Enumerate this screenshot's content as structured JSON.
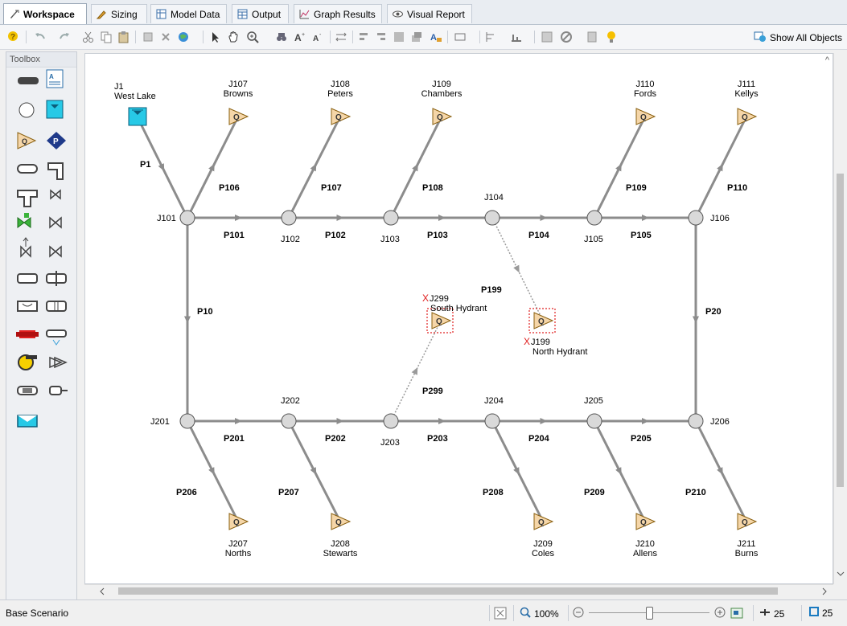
{
  "tabs": [
    {
      "label": "Workspace",
      "icon": "workspace-icon",
      "active": true
    },
    {
      "label": "Sizing",
      "icon": "pencil-icon",
      "active": false
    },
    {
      "label": "Model Data",
      "icon": "model-data-icon",
      "active": false
    },
    {
      "label": "Output",
      "icon": "output-table-icon",
      "active": false
    },
    {
      "label": "Graph Results",
      "icon": "graph-icon",
      "active": false
    },
    {
      "label": "Visual Report",
      "icon": "eye-icon",
      "active": false
    }
  ],
  "toolbar": {
    "show_all_label": "Show All Objects"
  },
  "toolbox": {
    "title": "Toolbox",
    "tools": [
      "pipe-tool",
      "annotation-tool",
      "branch-tool",
      "reservoir-tool",
      "assigned-flow-tool",
      "assigned-pressure-tool",
      "bend-tool",
      "elbow-tool",
      "tee-tool",
      "valve-tool",
      "control-valve-tool",
      "check-valve-tool",
      "relief-valve-tool",
      "three-way-valve-tool",
      "area-change-tool",
      "orifice-tool",
      "venturi-tool",
      "screen-tool",
      "heat-exchanger-tool",
      "spray-tool",
      "pump-tool",
      "compressor-tool",
      "general-component-tool",
      "dead-end-tool",
      "tank-tool"
    ]
  },
  "model": {
    "junctions": [
      {
        "id": "J101",
        "label": "J101"
      },
      {
        "id": "J102",
        "label": "J102"
      },
      {
        "id": "J103",
        "label": "J103"
      },
      {
        "id": "J104",
        "label": "J104"
      },
      {
        "id": "J105",
        "label": "J105"
      },
      {
        "id": "J106",
        "label": "J106"
      },
      {
        "id": "J201",
        "label": "J201"
      },
      {
        "id": "J202",
        "label": "J202"
      },
      {
        "id": "J203",
        "label": "J203"
      },
      {
        "id": "J204",
        "label": "J204"
      },
      {
        "id": "J205",
        "label": "J205"
      },
      {
        "id": "J206",
        "label": "J206"
      }
    ],
    "reservoir": {
      "id": "J1",
      "label": "J1",
      "name": "West Lake"
    },
    "flows_top": [
      {
        "id": "J107",
        "label": "J107",
        "name": "Browns"
      },
      {
        "id": "J108",
        "label": "J108",
        "name": "Peters"
      },
      {
        "id": "J109",
        "label": "J109",
        "name": "Chambers"
      },
      {
        "id": "J110",
        "label": "J110",
        "name": "Fords"
      },
      {
        "id": "J111",
        "label": "J111",
        "name": "Kellys"
      }
    ],
    "flows_bottom": [
      {
        "id": "J207",
        "label": "J207",
        "name": "Norths"
      },
      {
        "id": "J208",
        "label": "J208",
        "name": "Stewarts"
      },
      {
        "id": "J209",
        "label": "J209",
        "name": "Coles"
      },
      {
        "id": "J210",
        "label": "J210",
        "name": "Allens"
      },
      {
        "id": "J211",
        "label": "J211",
        "name": "Burns"
      }
    ],
    "hydrants": [
      {
        "id": "J299",
        "label": "J299",
        "name": "South Hydrant",
        "marker": "X"
      },
      {
        "id": "J199",
        "label": "J199",
        "name": "North Hydrant",
        "marker": "X"
      }
    ],
    "pipes": [
      "P1",
      "P10",
      "P20",
      "P101",
      "P102",
      "P103",
      "P104",
      "P105",
      "P106",
      "P107",
      "P108",
      "P109",
      "P110",
      "P199",
      "P201",
      "P202",
      "P203",
      "P204",
      "P205",
      "P206",
      "P207",
      "P208",
      "P209",
      "P210",
      "P299"
    ],
    "flow_symbol": "Q",
    "colors": {
      "pipe": "#8c8c8c",
      "junction_fill": "#d9d9d9",
      "flow_fill": "#f5d6a8",
      "reservoir_fill": "#27c9e6",
      "inactive": "#e02020"
    }
  },
  "status": {
    "scenario": "Base Scenario",
    "zoom": "100%",
    "pipe_count": "25",
    "junction_count": "25"
  }
}
